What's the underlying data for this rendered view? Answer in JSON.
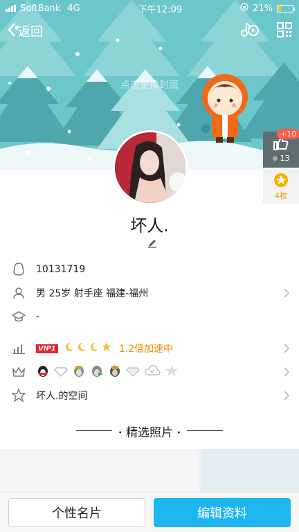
{
  "status_bar": {
    "carrier": "SoftBank",
    "network": "4G",
    "time": "下午12:09",
    "battery_percent": "21%",
    "battery_level": 0.21
  },
  "nav": {
    "back_label": "返回"
  },
  "cover": {
    "hint": "点击更换封面"
  },
  "like": {
    "badge": "+10",
    "count": "13"
  },
  "coin": {
    "label": "4枚"
  },
  "profile": {
    "nickname": "坏人.",
    "qq_number": "10131719",
    "basic_info": "男 25岁 射手座 福建-福州",
    "school": "-",
    "vip_label": "VIP1",
    "speed_text": "1.2倍加速中",
    "space_label": "坏人.的空间"
  },
  "photos": {
    "title": "精选照片"
  },
  "buttons": {
    "card": "个性名片",
    "edit": "编辑资料"
  },
  "colors": {
    "accent": "#1eb6f0",
    "vip_red": "#e8242a",
    "speed_orange": "#f08a00",
    "cover": "#6cc7cb"
  }
}
